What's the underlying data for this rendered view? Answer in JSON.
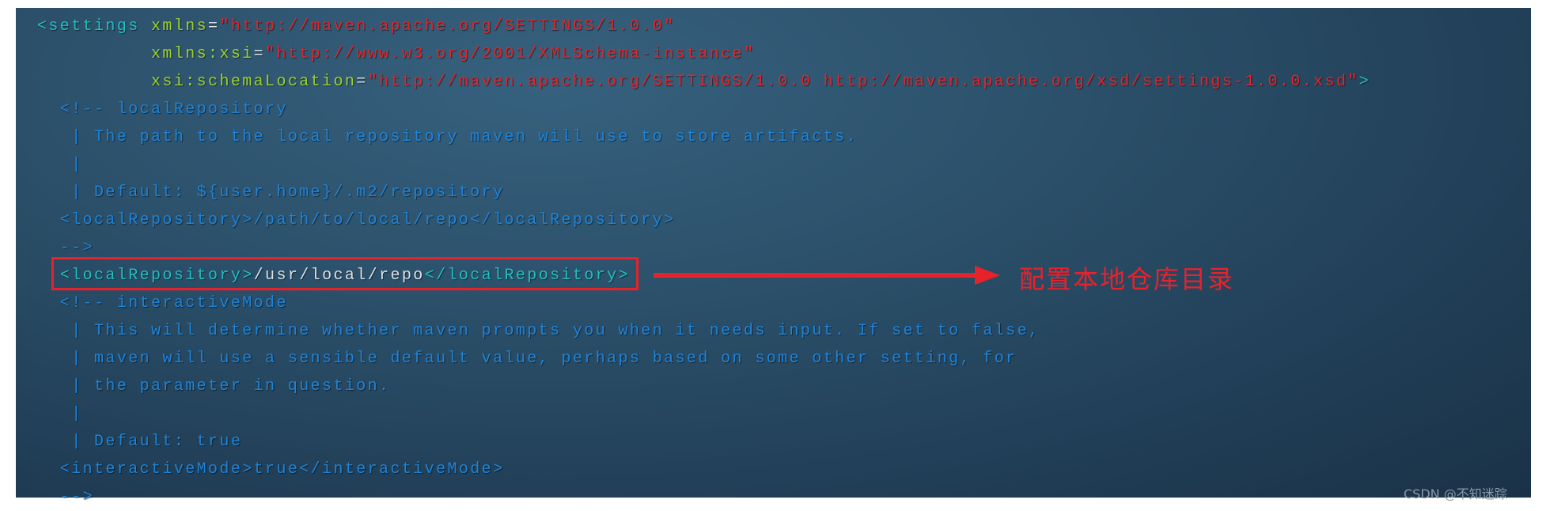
{
  "colors": {
    "tag": "#1fc1c4",
    "attribute": "#9bd32a",
    "string": "#e2252a",
    "comment": "#1f84d8",
    "text": "#dde3e8",
    "annotation": "#e8222b"
  },
  "code_lines": [
    [
      {
        "t": "tag",
        "v": "<settings "
      },
      {
        "t": "attr",
        "v": "xmlns"
      },
      {
        "t": "txt",
        "v": "="
      },
      {
        "t": "str",
        "v": "\"http://maven.apache.org/SETTINGS/1.0.0\""
      }
    ],
    [
      {
        "t": "txt",
        "v": "          "
      },
      {
        "t": "attr",
        "v": "xmlns:xsi"
      },
      {
        "t": "txt",
        "v": "="
      },
      {
        "t": "str",
        "v": "\"http://www.w3.org/2001/XMLSchema-instance\""
      }
    ],
    [
      {
        "t": "txt",
        "v": "          "
      },
      {
        "t": "attr",
        "v": "xsi:schemaLocation"
      },
      {
        "t": "txt",
        "v": "="
      },
      {
        "t": "str",
        "v": "\"http://maven.apache.org/SETTINGS/1.0.0 http://maven.apache.org/xsd/settings-1.0.0.xsd\""
      },
      {
        "t": "tag",
        "v": ">"
      }
    ],
    [
      {
        "t": "cmt",
        "v": "  <!-- localRepository"
      }
    ],
    [
      {
        "t": "cmt",
        "v": "   | The path to the local repository maven will use to store artifacts."
      }
    ],
    [
      {
        "t": "cmt",
        "v": "   |"
      }
    ],
    [
      {
        "t": "cmt",
        "v": "   | Default: ${user.home}/.m2/repository"
      }
    ],
    [
      {
        "t": "cmt",
        "v": "  <localRepository>/path/to/local/repo</localRepository>"
      }
    ],
    [
      {
        "t": "cmt",
        "v": "  -->"
      }
    ],
    [
      {
        "t": "txt",
        "v": "  "
      },
      {
        "t": "tag",
        "v": "<localRepository>"
      },
      {
        "t": "txt",
        "v": "/usr/local/repo"
      },
      {
        "t": "tag",
        "v": "</localRepository>"
      }
    ],
    [
      {
        "t": "cmt",
        "v": "  <!-- interactiveMode"
      }
    ],
    [
      {
        "t": "cmt",
        "v": "   | This will determine whether maven prompts you when it needs input. If set to false,"
      }
    ],
    [
      {
        "t": "cmt",
        "v": "   | maven will use a sensible default value, perhaps based on some other setting, for"
      }
    ],
    [
      {
        "t": "cmt",
        "v": "   | the parameter in question."
      }
    ],
    [
      {
        "t": "cmt",
        "v": "   |"
      }
    ],
    [
      {
        "t": "cmt",
        "v": "   | Default: true"
      }
    ],
    [
      {
        "t": "cmt",
        "v": "  <interactiveMode>true</interactiveMode>"
      }
    ],
    [
      {
        "t": "cmt",
        "v": "  -->"
      }
    ]
  ],
  "annotation": {
    "text": "配置本地仓库目录",
    "icon": "arrow-right-icon"
  },
  "watermark": "CSDN @不知迷踪"
}
